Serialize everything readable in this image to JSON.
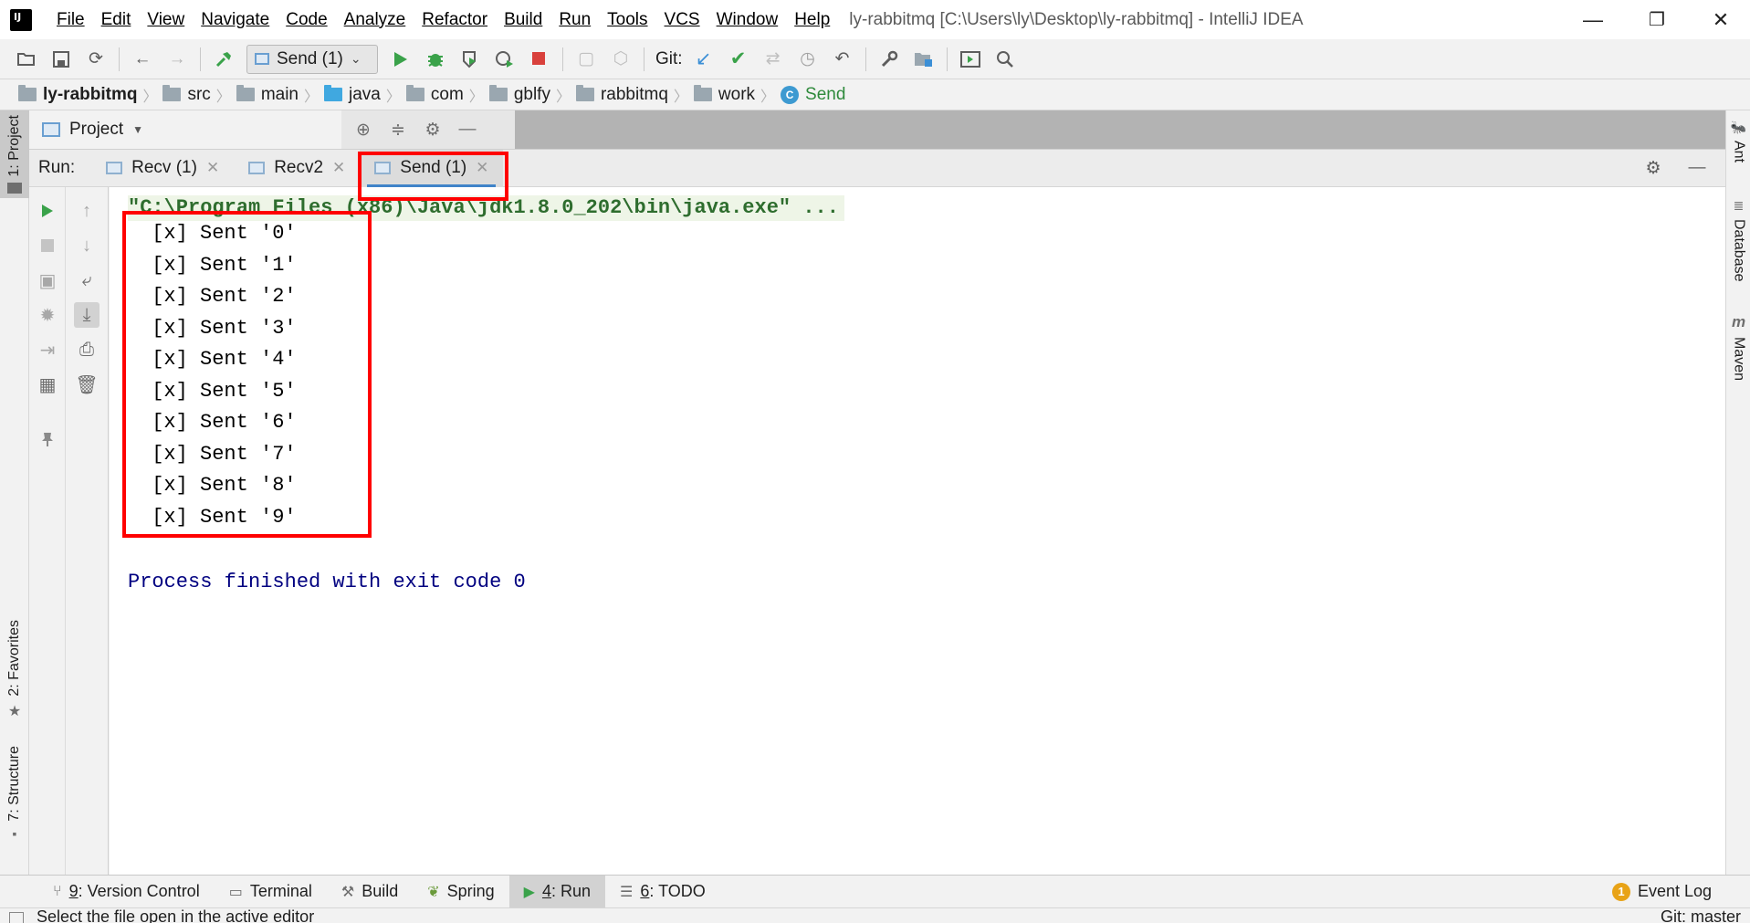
{
  "window": {
    "title": "ly-rabbitmq [C:\\Users\\ly\\Desktop\\ly-rabbitmq] - IntelliJ IDEA",
    "minimize": "—",
    "restore": "❐",
    "close": "✕"
  },
  "menu": [
    "File",
    "Edit",
    "View",
    "Navigate",
    "Code",
    "Analyze",
    "Refactor",
    "Build",
    "Run",
    "Tools",
    "VCS",
    "Window",
    "Help"
  ],
  "toolbar": {
    "run_config": "Send (1)",
    "git_label": "Git:"
  },
  "breadcrumb": [
    "ly-rabbitmq",
    "src",
    "main",
    "java",
    "com",
    "gblfy",
    "rabbitmq",
    "work",
    "Send"
  ],
  "left_stripe": {
    "project": "1: Project",
    "favorites": "2: Favorites",
    "structure": "7: Structure"
  },
  "right_stripe": {
    "ant": "Ant",
    "database": "Database",
    "maven": "Maven"
  },
  "project_panel": {
    "title": "Project"
  },
  "run_panel": {
    "label": "Run:",
    "tabs": [
      {
        "label": "Recv (1)"
      },
      {
        "label": "Recv2"
      },
      {
        "label": "Send (1)"
      }
    ]
  },
  "console": {
    "command": "\"C:\\Program Files (x86)\\Java\\jdk1.8.0_202\\bin\\java.exe\" ...",
    "lines": [
      " [x] Sent '0'",
      " [x] Sent '1'",
      " [x] Sent '2'",
      " [x] Sent '3'",
      " [x] Sent '4'",
      " [x] Sent '5'",
      " [x] Sent '6'",
      " [x] Sent '7'",
      " [x] Sent '8'",
      " [x] Sent '9'"
    ],
    "exit": "Process finished with exit code 0"
  },
  "bottom_tabs": [
    {
      "num": "9",
      "label": ": Version Control"
    },
    {
      "num": "",
      "label": "Terminal"
    },
    {
      "num": "",
      "label": "Build"
    },
    {
      "num": "",
      "label": "Spring"
    },
    {
      "num": "4",
      "label": ": Run"
    },
    {
      "num": "6",
      "label": ": TODO"
    }
  ],
  "event_log": {
    "badge": "1",
    "label": "Event Log"
  },
  "status": {
    "text": "Select the file open in the active editor",
    "git": "Git: master"
  },
  "colors": {
    "highlight": "#ff0000",
    "exit_text": "#000080",
    "command_text": "#2e6d2e"
  }
}
